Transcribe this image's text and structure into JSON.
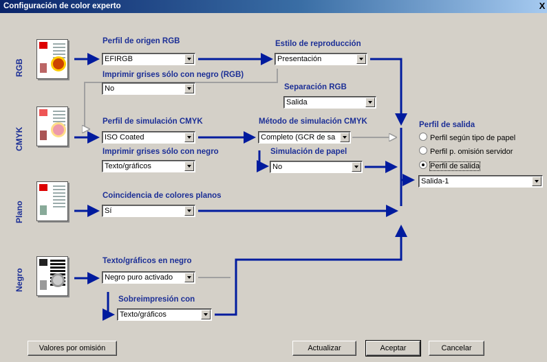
{
  "window": {
    "title": "Configuración de color experto",
    "close": "X"
  },
  "rows": {
    "rgb": "RGB",
    "cmyk": "CMYK",
    "plano": "Plano",
    "negro": "Negro"
  },
  "rgb": {
    "perfil_origen": {
      "label": "Perfil de origen RGB",
      "value": "EFIRGB"
    },
    "grises": {
      "label": "Imprimir grises sólo con negro (RGB)",
      "value": "No"
    },
    "estilo": {
      "label": "Estilo de reproducción",
      "value": "Presentación"
    },
    "separacion": {
      "label": "Separación RGB",
      "value": "Salida"
    }
  },
  "cmyk": {
    "perfil_sim": {
      "label": "Perfil de simulación CMYK",
      "value": "ISO Coated"
    },
    "grises": {
      "label": "Imprimir grises sólo con negro",
      "value": "Texto/gráficos"
    },
    "metodo": {
      "label": "Método de simulación CMYK",
      "value": "Completo (GCR de sa"
    },
    "papel": {
      "label": "Simulación de papel",
      "value": "No"
    }
  },
  "plano": {
    "coincidencia": {
      "label": "Coincidencia de colores planos",
      "value": "Sí"
    }
  },
  "negro": {
    "texto": {
      "label": "Texto/gráficos en negro",
      "value": "Negro puro activado"
    },
    "sobre": {
      "label": "Sobreimpresión con",
      "value": "Texto/gráficos"
    }
  },
  "salida": {
    "label": "Perfil de salida",
    "options": [
      "Perfil según tipo de papel",
      "Perfil p. omisión servidor",
      "Perfil de salida"
    ],
    "selected_index": 2,
    "value": "Salida-1"
  },
  "buttons": {
    "defaults": "Valores por omisión",
    "update": "Actualizar",
    "accept": "Aceptar",
    "cancel": "Cancelar"
  },
  "colors": {
    "accent": "#1c2f96",
    "flow": "#001b9e",
    "titlebar": "#0a246a"
  },
  "icons": [
    "document-icon",
    "color-swatch-icon",
    "grayscale-icon"
  ]
}
